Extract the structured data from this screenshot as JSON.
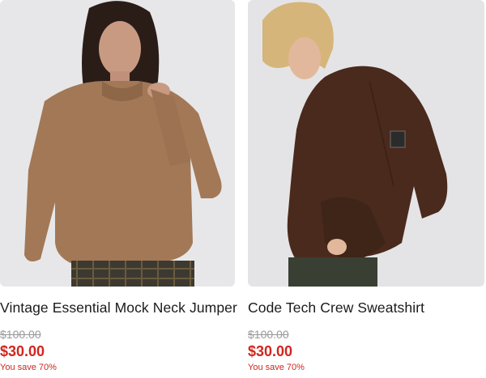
{
  "products": [
    {
      "image": "product-photo-brown-mock-neck-jumper",
      "title": "Vintage Essential Mock Neck Jumper",
      "was_price": "$100.00",
      "price": "$30.00",
      "savings": "You save 70%"
    },
    {
      "image": "product-photo-dark-brown-crew-sweatshirt",
      "title": "Code Tech Crew Sweatshirt",
      "was_price": "$100.00",
      "price": "$30.00",
      "savings": "You save 70%"
    }
  ],
  "colors": {
    "sale_price": "#d0261e",
    "was_price": "#9a9a9a",
    "title": "#1b1b1b",
    "photo_background": "#e6e6e8"
  }
}
